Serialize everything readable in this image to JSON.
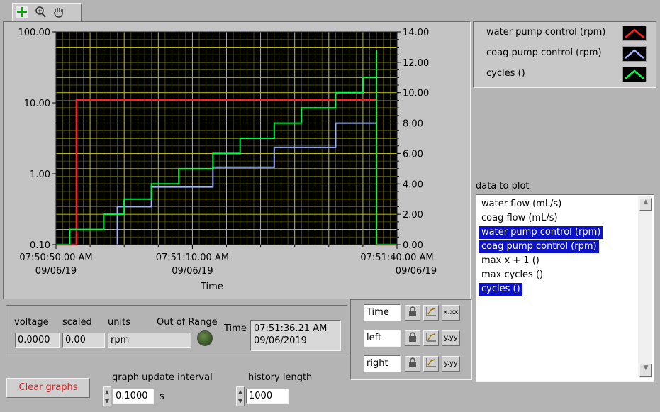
{
  "toolbar": {
    "icons": [
      "crosshair-cursor",
      "zoom",
      "pan-hand"
    ]
  },
  "graph": {
    "xlabel": "Time",
    "left_ticks": [
      "100.00",
      "10.00",
      "1.00",
      "0.10"
    ],
    "right_ticks": [
      "14.00",
      "12.00",
      "10.00",
      "8.00",
      "6.00",
      "4.00",
      "2.00",
      "0.00"
    ],
    "x_ticks": [
      {
        "time": "07:50:50.00 AM",
        "date": "09/06/19"
      },
      {
        "time": "07:51:10.00 AM",
        "date": "09/06/19"
      },
      {
        "time": "07:51:40.00 AM",
        "date": "09/06/19"
      }
    ]
  },
  "chart_data": {
    "type": "line",
    "xlabel": "Time",
    "x_range": [
      "07:50:50.00 AM",
      "07:51:40.00 AM"
    ],
    "y_left": {
      "scale": "log",
      "range": [
        0.1,
        100
      ]
    },
    "y_right": {
      "scale": "linear",
      "range": [
        0,
        14
      ]
    },
    "grid": true,
    "legend_position": "top-right",
    "series": [
      {
        "name": "water pump control (rpm)",
        "color": "#ff2020",
        "axis": "left",
        "points": [
          [
            "07:50:50",
            0.1
          ],
          [
            "07:50:53",
            0.1
          ],
          [
            "07:50:53",
            11
          ],
          [
            "07:51:37",
            11
          ],
          [
            "07:51:37",
            0.1
          ],
          [
            "07:51:40",
            0.1
          ]
        ]
      },
      {
        "name": "coag pump control (rpm)",
        "color": "#a0b4ff",
        "axis": "right",
        "points": [
          [
            "07:50:59",
            0
          ],
          [
            "07:50:59",
            2.5
          ],
          [
            "07:51:04",
            2.5
          ],
          [
            "07:51:04",
            3.8
          ],
          [
            "07:51:13",
            3.8
          ],
          [
            "07:51:13",
            5.1
          ],
          [
            "07:51:22",
            5.1
          ],
          [
            "07:51:22",
            6.4
          ],
          [
            "07:51:31",
            6.4
          ],
          [
            "07:51:31",
            8.0
          ],
          [
            "07:51:37",
            8.0
          ]
        ]
      },
      {
        "name": "cycles ()",
        "color": "#00ff40",
        "axis": "right",
        "points": [
          [
            "07:50:50",
            0
          ],
          [
            "07:50:52",
            0
          ],
          [
            "07:50:52",
            1
          ],
          [
            "07:50:57",
            1
          ],
          [
            "07:50:57",
            2
          ],
          [
            "07:51:00",
            2
          ],
          [
            "07:51:00",
            3
          ],
          [
            "07:51:04",
            3
          ],
          [
            "07:51:04",
            4
          ],
          [
            "07:51:08",
            4
          ],
          [
            "07:51:08",
            5
          ],
          [
            "07:51:13",
            5
          ],
          [
            "07:51:13",
            6
          ],
          [
            "07:51:17",
            6
          ],
          [
            "07:51:17",
            7
          ],
          [
            "07:51:22",
            7
          ],
          [
            "07:51:22",
            8
          ],
          [
            "07:51:26",
            8
          ],
          [
            "07:51:26",
            9
          ],
          [
            "07:51:31",
            9
          ],
          [
            "07:51:31",
            10
          ],
          [
            "07:51:35",
            10
          ],
          [
            "07:51:35",
            11
          ],
          [
            "07:51:37",
            11
          ],
          [
            "07:51:37",
            12.2
          ],
          [
            "07:51:37",
            12.8
          ],
          [
            "07:51:37",
            0
          ],
          [
            "07:51:40",
            0
          ]
        ]
      }
    ]
  },
  "legend": [
    {
      "label": "water pump control (rpm)",
      "color": "#ff2020"
    },
    {
      "label": "coag pump control (rpm)",
      "color": "#a0b4ff"
    },
    {
      "label": "cycles ()",
      "color": "#00ff40"
    }
  ],
  "data_to_plot": {
    "label": "data to plot",
    "items": [
      {
        "label": "water flow (mL/s)",
        "selected": false
      },
      {
        "label": "coag flow (mL/s)",
        "selected": false
      },
      {
        "label": "water pump control (rpm)",
        "selected": true
      },
      {
        "label": "coag pump control (rpm)",
        "selected": true
      },
      {
        "label": "max x + 1 ()",
        "selected": false
      },
      {
        "label": "max cycles ()",
        "selected": false
      },
      {
        "label": "cycles ()",
        "selected": true
      }
    ]
  },
  "readout": {
    "voltage_label": "voltage",
    "voltage": "0.0000",
    "scaled_label": "scaled",
    "scaled": "0.00",
    "units_label": "units",
    "units": "rpm",
    "oor_label": "Out of Range",
    "time_label": "Time",
    "time_line1": "07:51:36.21 AM",
    "time_line2": "09/06/2019"
  },
  "scales": [
    {
      "name": "Time",
      "lock": "🔒",
      "fmt_btn": "x.xx"
    },
    {
      "name": "left",
      "lock": "🔒",
      "fmt_btn": "y.yy"
    },
    {
      "name": "right",
      "lock": "🔒",
      "fmt_btn": "y.yy"
    }
  ],
  "controls": {
    "clear_label": "Clear graphs",
    "interval_label": "graph update interval",
    "interval": "0.1000",
    "interval_unit": "s",
    "history_label": "history length",
    "history": "1000"
  }
}
